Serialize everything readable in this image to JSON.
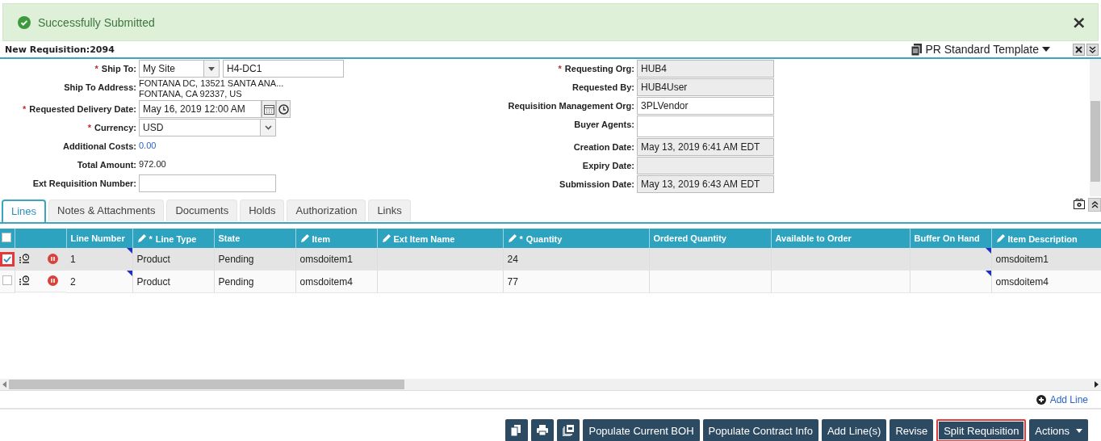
{
  "notification": {
    "message": "Successfully Submitted",
    "close": "×"
  },
  "header": {
    "title": "New Requisition:2094",
    "template": "PR Standard Template"
  },
  "form_left": [
    {
      "label": "Ship To:",
      "required_mark": "*",
      "kind": "shipto",
      "value": "My Site",
      "value_2": "H4-DC1"
    },
    {
      "label": "Ship To Address:",
      "kind": "multiline",
      "lines": [
        "FONTANA DC, 13521 SANTA ANA...",
        "FONTANA, CA 92337, US"
      ]
    },
    {
      "label": "Requested Delivery Date:",
      "required_mark": "*",
      "kind": "datetime",
      "value": "May 16, 2019 12:00 AM"
    },
    {
      "label": "Currency:",
      "required_mark": "*",
      "kind": "select",
      "value": "USD"
    },
    {
      "label": "Additional Costs:",
      "kind": "link",
      "value": "0.00"
    },
    {
      "label": "Total Amount:",
      "kind": "text",
      "value": "972.00"
    },
    {
      "label": "Ext Requisition Number:",
      "kind": "input"
    }
  ],
  "form_right": [
    {
      "label": "Requesting Org:",
      "required_mark": "*",
      "readonly": true,
      "value": "HUB4"
    },
    {
      "label": "Requested By:",
      "readonly": true,
      "value": "HUB4User"
    },
    {
      "label": "Requisition Management Org:",
      "readonly": false,
      "value": "3PLVendor"
    },
    {
      "label": "Buyer Agents:",
      "readonly": false,
      "tall": true
    },
    {
      "label": "Creation Date:",
      "readonly": true,
      "value": "May 13, 2019 6:41 AM EDT"
    },
    {
      "label": "Expiry Date:",
      "readonly": true
    },
    {
      "label": "Submission Date:",
      "readonly": true,
      "value": "May 13, 2019 6:43 AM EDT"
    }
  ],
  "tabs": [
    {
      "label": "Lines",
      "selected": true
    },
    {
      "label": "Notes & Attachments",
      "selected": false
    },
    {
      "label": "Documents",
      "selected": false
    },
    {
      "label": "Holds",
      "selected": false
    },
    {
      "label": "Authorization",
      "selected": false
    },
    {
      "label": "Links",
      "selected": false
    }
  ],
  "table": {
    "select_all_checked": false,
    "columns": [
      {
        "label": "Line Number",
        "editable": false
      },
      {
        "label": "Line Type",
        "editable": true,
        "required_mark": "*"
      },
      {
        "label": "State",
        "editable": false
      },
      {
        "label": "Item",
        "editable": true
      },
      {
        "label": "Ext Item Name",
        "editable": true
      },
      {
        "label": "Quantity",
        "editable": true,
        "required_mark": "*"
      },
      {
        "label": "Ordered Quantity",
        "editable": false
      },
      {
        "label": "Available to Order",
        "editable": false
      },
      {
        "label": "Buffer On Hand",
        "editable": false
      },
      {
        "label": "Item Description",
        "editable": true
      }
    ],
    "rows": [
      {
        "selected": true,
        "checked": true,
        "highlighted": true,
        "cells": [
          "1",
          "Product",
          "Pending",
          "omsdoitem1",
          "",
          "24",
          "",
          "",
          "",
          "omsdoitem1"
        ]
      },
      {
        "selected": false,
        "checked": false,
        "highlighted": false,
        "cells": [
          "2",
          "Product",
          "Pending",
          "omsdoitem4",
          "",
          "77",
          "",
          "",
          "",
          "omsdoitem4"
        ]
      }
    ]
  },
  "add_line": "Add Line",
  "buttons": [
    {
      "kind": "copy"
    },
    {
      "kind": "print"
    },
    {
      "kind": "archive"
    },
    {
      "kind": "text",
      "label": "Populate Current BOH",
      "highlighted": false
    },
    {
      "kind": "text",
      "label": "Populate Contract Info",
      "highlighted": false
    },
    {
      "kind": "text",
      "label": "Add Line(s)",
      "highlighted": false
    },
    {
      "kind": "text",
      "label": "Revise",
      "highlighted": false
    },
    {
      "kind": "text",
      "label": "Split Requisition",
      "highlighted": true
    },
    {
      "kind": "dropdown",
      "label": "Actions",
      "highlighted": false
    }
  ]
}
